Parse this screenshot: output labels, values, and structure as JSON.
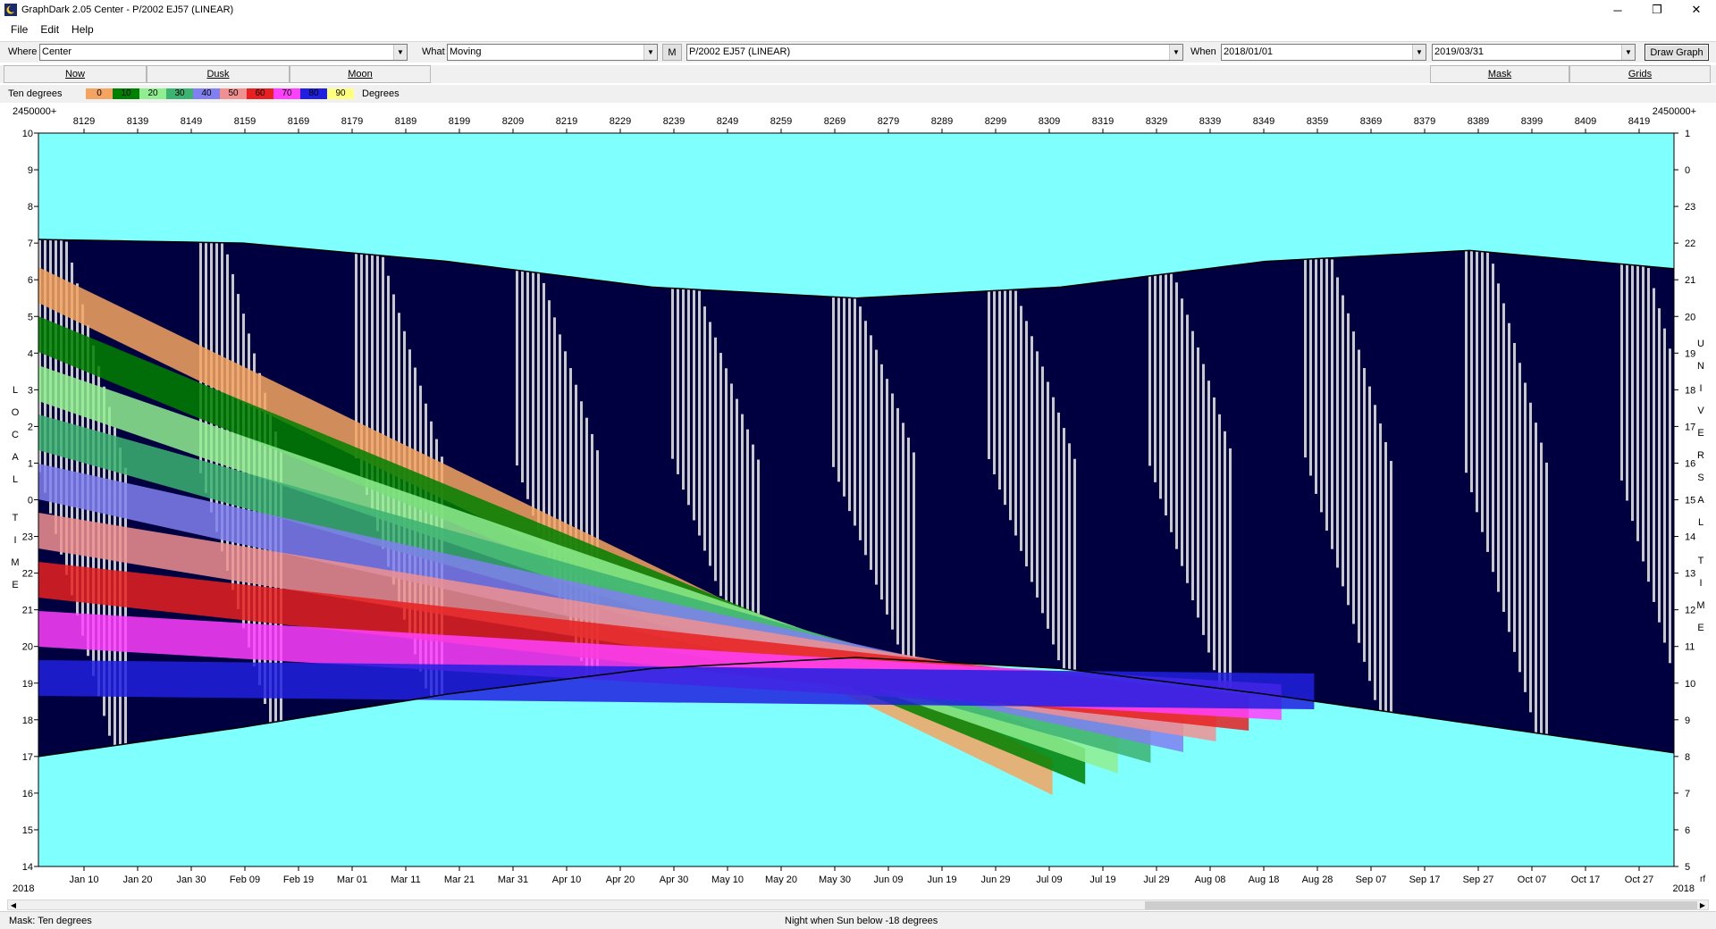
{
  "window": {
    "title": "GraphDark 2.05  Center  -  P/2002 EJ57 (LINEAR)",
    "controls": {
      "minimize": "─",
      "maximize": "❐",
      "close": "✕"
    }
  },
  "menu": [
    "File",
    "Edit",
    "Help"
  ],
  "toolbar": {
    "where_label": "Where",
    "where_value": "Center",
    "what_label": "What",
    "what_value": "Moving",
    "m_button": "M",
    "object_value": "P/2002 EJ57 (LINEAR)",
    "when_label": "When",
    "when_start": "2018/01/01",
    "when_end": "2019/03/31",
    "draw_button": "Draw Graph"
  },
  "tabs": {
    "now": "Now",
    "dusk": "Dusk",
    "moon": "Moon",
    "mask": "Mask",
    "grids": "Grids"
  },
  "legend": {
    "label": "Ten degrees",
    "suffix": "Degrees",
    "swatches": [
      {
        "text": "0",
        "color": "#f4a460"
      },
      {
        "text": "10",
        "color": "#008000"
      },
      {
        "text": "20",
        "color": "#90ee90"
      },
      {
        "text": "30",
        "color": "#3cb371"
      },
      {
        "text": "40",
        "color": "#8080f0"
      },
      {
        "text": "50",
        "color": "#f09090"
      },
      {
        "text": "60",
        "color": "#e82020"
      },
      {
        "text": "70",
        "color": "#ff40ff"
      },
      {
        "text": "80",
        "color": "#2020e0"
      },
      {
        "text": "90",
        "color": "#ffff80"
      }
    ]
  },
  "chart_data": {
    "type": "heatmap",
    "jd_prefix_left": "2450000+",
    "jd_prefix_right": "2450000+",
    "jd_ticks": [
      8129,
      8139,
      8149,
      8159,
      8169,
      8179,
      8189,
      8199,
      8209,
      8219,
      8229,
      8239,
      8249,
      8259,
      8269,
      8279,
      8289,
      8299,
      8309,
      8319,
      8329,
      8339,
      8349,
      8359,
      8369,
      8379,
      8389,
      8399,
      8409,
      8419
    ],
    "date_ticks": [
      "Jan 10",
      "Jan 20",
      "Jan 30",
      "Feb 09",
      "Feb 19",
      "Mar 01",
      "Mar 11",
      "Mar 21",
      "Mar 31",
      "Apr 10",
      "Apr 20",
      "Apr 30",
      "May 10",
      "May 20",
      "May 30",
      "Jun 09",
      "Jun 19",
      "Jun 29",
      "Jul 09",
      "Jul 19",
      "Jul 29",
      "Aug 08",
      "Aug 18",
      "Aug 28",
      "Sep 07",
      "Sep 17",
      "Sep 27",
      "Oct 07",
      "Oct 17",
      "Oct 27"
    ],
    "year_left": "2018",
    "year_right": "2018",
    "right_corner": "rf",
    "left_axis_label": "LOCAL TIME",
    "right_axis_label": "UNIVERSAL TIME",
    "left_ticks": [
      "10",
      "9",
      "8",
      "7",
      "6",
      "5",
      "4",
      "3",
      "2",
      "1",
      "0",
      "23",
      "22",
      "21",
      "20",
      "19",
      "18",
      "17",
      "16",
      "15",
      "14"
    ],
    "right_ticks": [
      "1",
      "0",
      "23",
      "22",
      "21",
      "20",
      "19",
      "18",
      "17",
      "16",
      "15",
      "14",
      "13",
      "12",
      "11",
      "10",
      "9",
      "8",
      "7",
      "6",
      "5"
    ],
    "x_start_jd": 8120.5,
    "x_end_jd": 8425.5,
    "first_tick_jd": 8129,
    "y_range_local_hours_from_top": [
      0,
      20
    ],
    "dusk_end_local_hour": [
      17.0,
      17.8,
      18.7,
      19.4,
      19.7,
      19.4,
      18.7,
      17.9,
      17.1
    ],
    "dawn_start_local_hour": [
      7.1,
      7.0,
      6.5,
      5.8,
      5.5,
      5.8,
      6.5,
      6.8,
      6.3
    ],
    "sample_months_for_night_limits": [
      "Jan",
      "Feb",
      "Apr",
      "May",
      "Jun",
      "Jul",
      "Aug",
      "Sep",
      "Oct"
    ],
    "background_color": "#80ffff",
    "moon_up_color": "#c8c8c8",
    "twilight_color": "#0080c0",
    "dark_color": "#000040"
  },
  "status": {
    "mask": "Mask:  Ten degrees",
    "night": "Night when Sun below -18 degrees"
  }
}
